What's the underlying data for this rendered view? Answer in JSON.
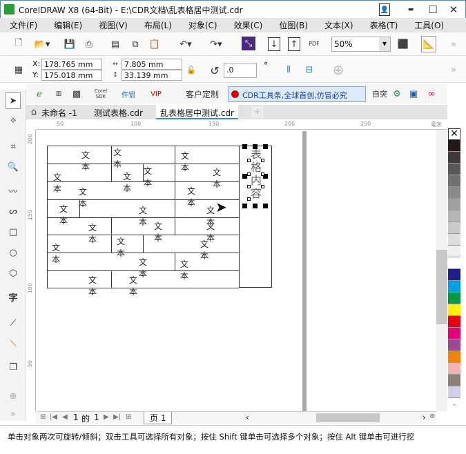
{
  "window": {
    "title": "CorelDRAW X8 (64-Bit) - E:\\CDR文档\\乱表格居中测试.cdr",
    "minimize": "▬",
    "maximize": "☐",
    "close": "✕"
  },
  "menu": [
    "文件(F)",
    "编辑(E)",
    "视图(V)",
    "布局(L)",
    "对象(C)",
    "效果(C)",
    "位图(B)",
    "文本(X)",
    "表格(T)",
    "工具(O)"
  ],
  "toolbar": {
    "zoom_value": "50%",
    "pdf_label": "PDF",
    "more": "»"
  },
  "property_bar": {
    "x_label": "X:",
    "x_value": "178.765 mm",
    "y_label": "Y:",
    "y_value": "175.018 mm",
    "width_value": "7.805 mm",
    "height_value": "33.139 mm",
    "rotation_value": ".0",
    "degree_symbol": "°"
  },
  "custom_bar": {
    "corel_sdk": "Corel SDK",
    "plugin": "件铝",
    "vip": "VIP",
    "customize": "客户定制",
    "banner": "CDR工具条,全球首创,仿冒必究",
    "label": "自突"
  },
  "tabs": [
    {
      "label": "未命名 -1"
    },
    {
      "label": "测试表格.cdr"
    },
    {
      "label": "乱表格居中测试.cdr",
      "active": true
    }
  ],
  "ruler": {
    "top": [
      "50",
      "100",
      "150",
      "200",
      "250"
    ],
    "unit": "毫米",
    "left": [
      "200",
      "150",
      "100",
      "50"
    ]
  },
  "canvas": {
    "cells": [
      "文本",
      "文本",
      "文本",
      "文本",
      "文本",
      "文本",
      "文本",
      "文本",
      "文本",
      "文本",
      "文本",
      "文本",
      "文本",
      "文本",
      "文本",
      "文本",
      "文本",
      "文本",
      "文本",
      "文本",
      "文本",
      "文本"
    ],
    "vertical_text": [
      "表",
      "格",
      "内",
      "容"
    ]
  },
  "palette": [
    "#231815",
    "#3e3a39",
    "#595757",
    "#727171",
    "#898989",
    "#9fa0a0",
    "#b5b5b6",
    "#c9caca",
    "#dcdddd",
    "#efefef",
    "#ffffff",
    "#1d2088",
    "#00a0e9",
    "#009944",
    "#fff100",
    "#e60012",
    "#e4007f",
    "#a0488f",
    "#f08300",
    "#f5b2b2",
    "#8c8077",
    "#d2d0e6"
  ],
  "page_nav": {
    "current": "1",
    "of": "的",
    "total": "1",
    "page_tab": "页 1"
  },
  "status": "单击对象两次可旋转/倾斜；双击工具可选择所有对象；按住 Shift 键单击可选择多个对象；按住 Alt 键单击可进行挖"
}
